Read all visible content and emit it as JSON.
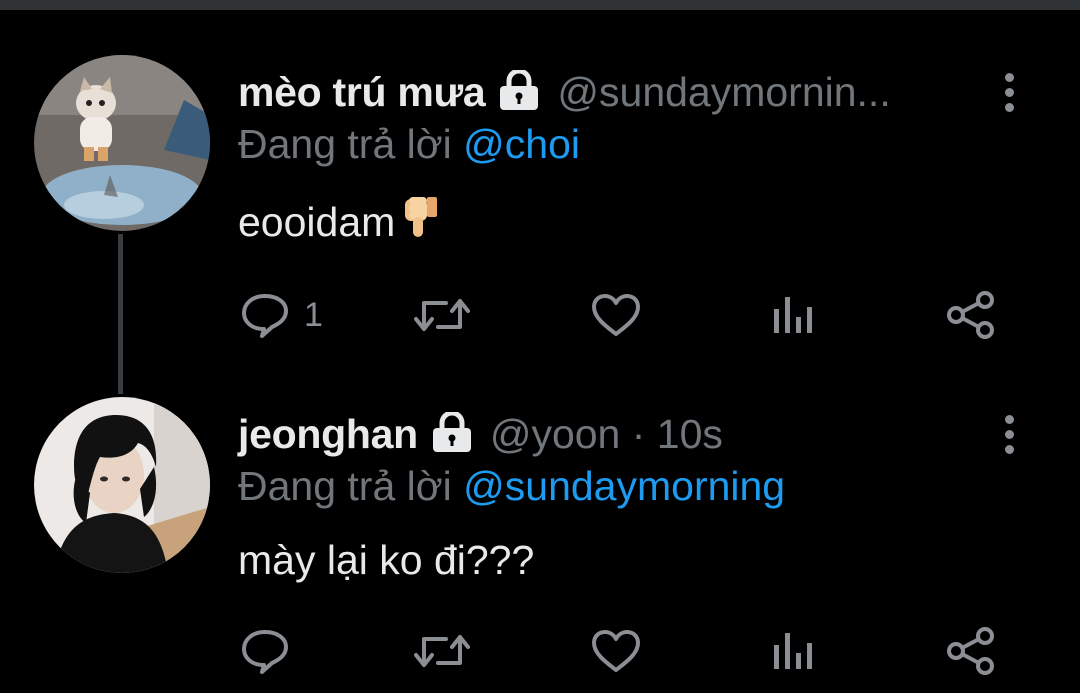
{
  "tweets": [
    {
      "display_name": "mèo trú mưa",
      "handle": "@sundaymornin...",
      "time": "",
      "replying_prefix": "Đang trả lời",
      "replying_to": "@choi",
      "text": "eooidam",
      "emoji": "thumbs-down",
      "reply_count": "1"
    },
    {
      "display_name": "jeonghan",
      "handle": "@yoon · 10s",
      "time": "",
      "replying_prefix": "Đang trả lời",
      "replying_to": "@sundaymorning",
      "text": "mày lại ko đi???",
      "emoji": "",
      "reply_count": ""
    }
  ],
  "colors": {
    "background": "#000000",
    "primary_text": "#e7e9ea",
    "secondary_text": "#71767b",
    "mention": "#1d9bf0",
    "icon": "#8b8f94"
  }
}
